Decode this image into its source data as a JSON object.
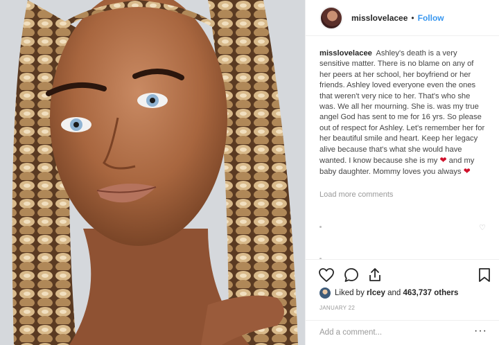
{
  "post": {
    "username": "misslovelacee",
    "separator": "•",
    "follow_label": "Follow",
    "caption_user": "misslovelacee",
    "caption_parts": [
      "Ashley's death is a very sensitive matter. There is no blame on any of her peers at her school, her boyfriend or her friends. Ashley loved everyone even the ones that weren't very nice to her. That's who she was. We all her mourning. She is. was my true angel God has sent to me for 16 yrs. So please out of respect for Ashley. Let's remember her for her beautiful smile and heart. Keep her legacy alive because that's what she would have wanted. I know because she is my",
      "and my baby daughter. Mommy loves you always"
    ],
    "heart_emoji": "❤",
    "load_more": "Load more comments",
    "likes_prefix": "Liked by",
    "likes_user": "rlcey",
    "likes_and": "and",
    "likes_count": "463,737 others",
    "date": "JANUARY 22",
    "comment_placeholder": "Add a comment...",
    "more_glyph": "···",
    "small_heart": "♡"
  },
  "icons": [
    "heart-icon",
    "comment-icon",
    "share-icon",
    "bookmark-icon"
  ],
  "colors": {
    "accent": "#3897f0",
    "text": "#262626",
    "muted": "#999999",
    "heart_red": "#d0112b"
  }
}
